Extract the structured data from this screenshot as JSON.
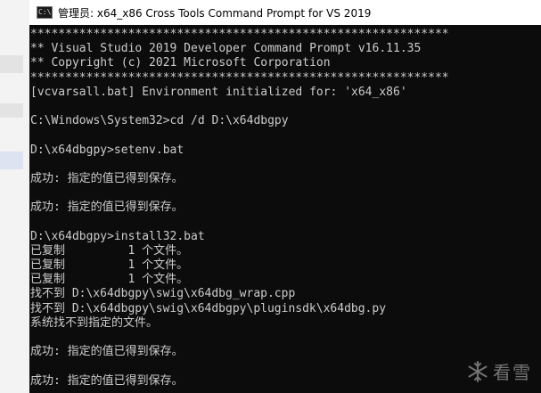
{
  "window": {
    "title": "管理员: x64_x86 Cross Tools Command Prompt for VS 2019",
    "icon": "cmd-prompt-icon",
    "icon_glyph": "C:\\"
  },
  "console": {
    "lines": [
      "************************************************************",
      "** Visual Studio 2019 Developer Command Prompt v16.11.35",
      "** Copyright (c) 2021 Microsoft Corporation",
      "************************************************************",
      "[vcvarsall.bat] Environment initialized for: 'x64_x86'",
      "",
      "C:\\Windows\\System32>cd /d D:\\x64dbgpy",
      "",
      "D:\\x64dbgpy>setenv.bat",
      "",
      "成功: 指定的值已得到保存。",
      "",
      "成功: 指定的值已得到保存。",
      "",
      "D:\\x64dbgpy>install32.bat",
      "已复制         1 个文件。",
      "已复制         1 个文件。",
      "已复制         1 个文件。",
      "找不到 D:\\x64dbgpy\\swig\\x64dbg_wrap.cpp",
      "找不到 D:\\x64dbgpy\\swig\\x64dbgpy\\pluginsdk\\x64dbg.py",
      "系统找不到指定的文件。",
      "",
      "成功: 指定的值已得到保存。",
      "",
      "成功: 指定的值已得到保存。"
    ]
  },
  "watermark": {
    "text": "看雪",
    "icon": "snowflake-icon",
    "color": "#c8c8c8"
  },
  "colors": {
    "console_bg": "#0c0c0c",
    "console_fg": "#cccccc",
    "titlebar_bg": "#ffffff"
  }
}
